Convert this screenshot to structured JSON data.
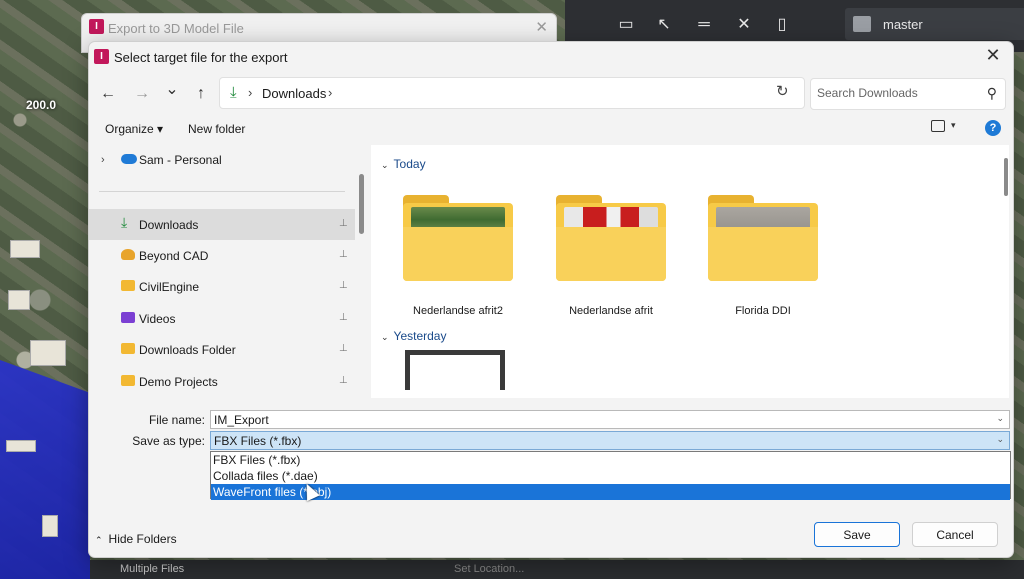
{
  "background_app": {
    "map_label": "200.0",
    "branch_label": "master",
    "footer_left": "Multiple Files",
    "footer_right": "Set Location..."
  },
  "parent_window": {
    "app_icon_letter": "I",
    "title": "Export to 3D Model File",
    "close_glyph": "✕"
  },
  "dialog": {
    "app_icon_letter": "I",
    "title": "Select target file for the export",
    "close_glyph": "✕"
  },
  "navigation": {
    "back_glyph": "←",
    "forward_glyph": "→",
    "recent_glyph": "⌄",
    "up_glyph": "↑",
    "breadcrumb": [
      "Downloads"
    ],
    "breadcrumb_sep": "›",
    "refresh_glyph": "↻",
    "search_placeholder": "Search Downloads",
    "search_glyph": "⚲"
  },
  "command_bar": {
    "organize_label": "Organize ▾",
    "new_folder_label": "New folder",
    "help_glyph": "?"
  },
  "nav_pane": {
    "onedrive_label": "Sam - Personal",
    "items": [
      {
        "label": "Downloads",
        "icon": "download-icon",
        "pinned": true,
        "selected": true
      },
      {
        "label": "Beyond CAD",
        "icon": "person-folder-icon",
        "pinned": true,
        "selected": false
      },
      {
        "label": "CivilEngine",
        "icon": "folder-icon",
        "pinned": true,
        "selected": false
      },
      {
        "label": "Videos",
        "icon": "videos-icon",
        "pinned": true,
        "selected": false
      },
      {
        "label": "Downloads Folder",
        "icon": "folder-icon",
        "pinned": true,
        "selected": false
      },
      {
        "label": "Demo Projects",
        "icon": "folder-icon",
        "pinned": true,
        "selected": false
      }
    ],
    "pin_glyph": "📌"
  },
  "content": {
    "groups": [
      {
        "label": "Today",
        "items": [
          "Nederlandse afrit2",
          "Nederlandse afrit",
          "Florida DDI"
        ]
      },
      {
        "label": "Yesterday",
        "items": []
      }
    ]
  },
  "form": {
    "file_name_label": "File name:",
    "file_name_value": "IM_Export",
    "save_type_label": "Save as type:",
    "save_type_selected": "FBX Files (*.fbx)",
    "save_type_options": [
      "FBX Files (*.fbx)",
      "Collada files (*.dae)",
      "WaveFront files (*.obj)"
    ],
    "highlighted_option_index": 2
  },
  "footer": {
    "hide_folders_label": "Hide Folders",
    "save_label": "Save",
    "cancel_label": "Cancel"
  },
  "colors": {
    "accent": "#1a74d8",
    "folder": "#f7ca47",
    "app_icon": "#c2185b"
  }
}
